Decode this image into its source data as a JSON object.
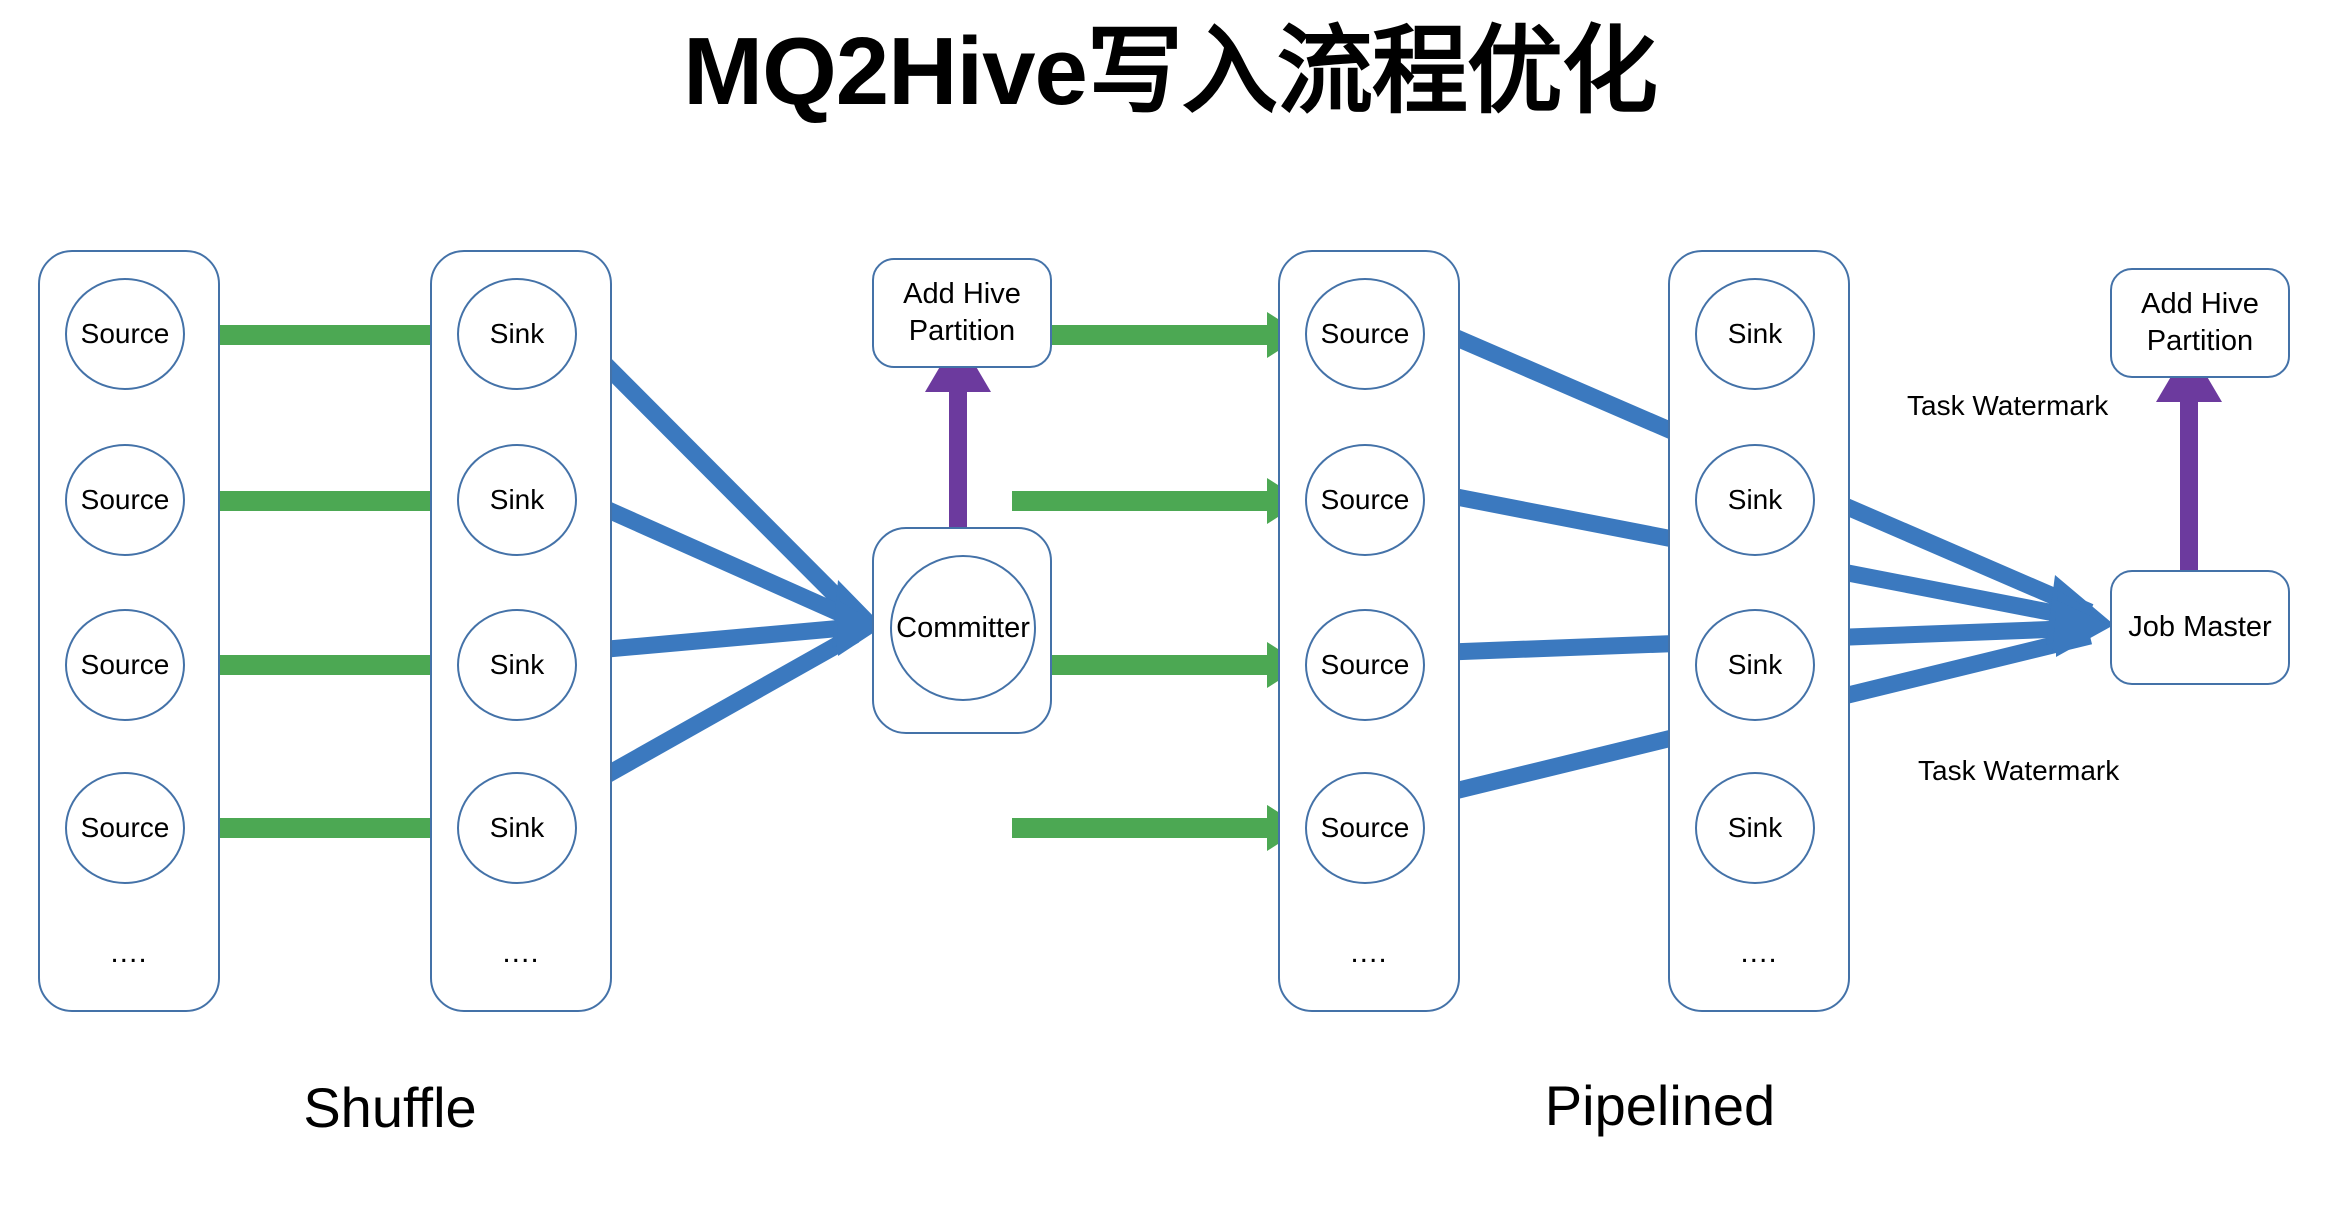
{
  "title": "MQ2Hive写入流程优化",
  "colors": {
    "outline": "#4472a8",
    "source_arrow": "#4ca853",
    "sink_arrow": "#3b79bf",
    "partition_arrow": "#6c3a9e",
    "text": "#000000",
    "background": "#ffffff"
  },
  "left": {
    "caption": "Shuffle",
    "source_lane": {
      "nodes": [
        {
          "label": "Source"
        },
        {
          "label": "Source"
        },
        {
          "label": "Source"
        },
        {
          "label": "Source"
        }
      ],
      "ellipsis": "...."
    },
    "sink_lane": {
      "nodes": [
        {
          "label": "Sink"
        },
        {
          "label": "Sink"
        },
        {
          "label": "Sink"
        },
        {
          "label": "Sink"
        }
      ],
      "ellipsis": "...."
    },
    "committer": {
      "label": "Committer"
    },
    "add_partition": {
      "label": "Add Hive\nPartition",
      "line1": "Add Hive",
      "line2": "Partition"
    },
    "edge_labels": []
  },
  "right": {
    "caption": "Pipelined",
    "source_lane": {
      "nodes": [
        {
          "label": "Source"
        },
        {
          "label": "Source"
        },
        {
          "label": "Source"
        },
        {
          "label": "Source"
        }
      ],
      "ellipsis": "...."
    },
    "sink_lane": {
      "nodes": [
        {
          "label": "Sink"
        },
        {
          "label": "Sink"
        },
        {
          "label": "Sink"
        },
        {
          "label": "Sink"
        }
      ],
      "ellipsis": "...."
    },
    "job_master": {
      "label": "Job Master"
    },
    "add_partition": {
      "line1": "Add Hive",
      "line2": "Partition"
    },
    "edge_labels": [
      {
        "text": "Task Watermark"
      },
      {
        "text": "Task Watermark"
      }
    ]
  }
}
